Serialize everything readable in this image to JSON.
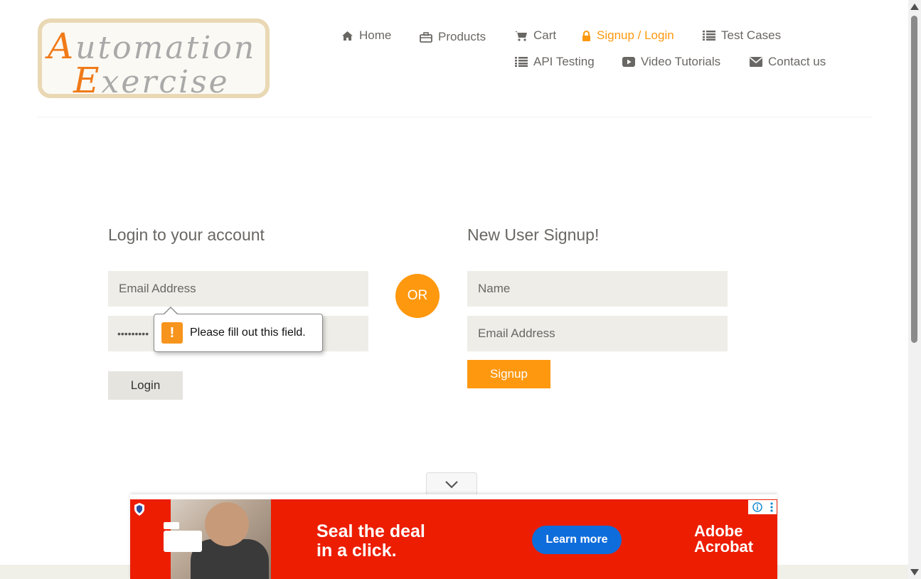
{
  "logo": {
    "line1": "Automation",
    "line2": "Exercise",
    "line1_cap": "A",
    "line1_rest": "utomation",
    "line2_cap": "E",
    "line2_rest": "xercise"
  },
  "nav": {
    "items": [
      {
        "label": "Home",
        "icon": "home-icon"
      },
      {
        "label": "Products",
        "icon": "briefcase-icon"
      },
      {
        "label": "Cart",
        "icon": "shopping-cart-icon"
      },
      {
        "label": "Signup / Login",
        "icon": "lock-icon",
        "active": true
      },
      {
        "label": "Test Cases",
        "icon": "list-icon"
      },
      {
        "label": "API Testing",
        "icon": "list-icon"
      },
      {
        "label": "Video Tutorials",
        "icon": "youtube-play-icon"
      },
      {
        "label": "Contact us",
        "icon": "envelope-icon"
      }
    ],
    "active_color": "#fe980f"
  },
  "login": {
    "heading": "Login to your account",
    "email_placeholder": "Email Address",
    "password_value": "•••••••••",
    "button": "Login"
  },
  "or_label": "OR",
  "signup": {
    "heading": "New User Signup!",
    "name_placeholder": "Name",
    "email_placeholder": "Email Address",
    "button": "Signup"
  },
  "validation": {
    "message": "Please fill out this field.",
    "icon": "warning-icon"
  },
  "ad": {
    "headline_line1": "Seal the deal",
    "headline_line2": "in a click.",
    "cta": "Learn more",
    "brand_line1": "Adobe",
    "brand_line2": "Acrobat",
    "background": "#ec1d01",
    "cta_color": "#0f6ddb",
    "collapse_icon": "chevron-down-icon"
  },
  "colors": {
    "accent": "#fe980f",
    "text": "#696763",
    "field_bg": "#eeede8"
  }
}
